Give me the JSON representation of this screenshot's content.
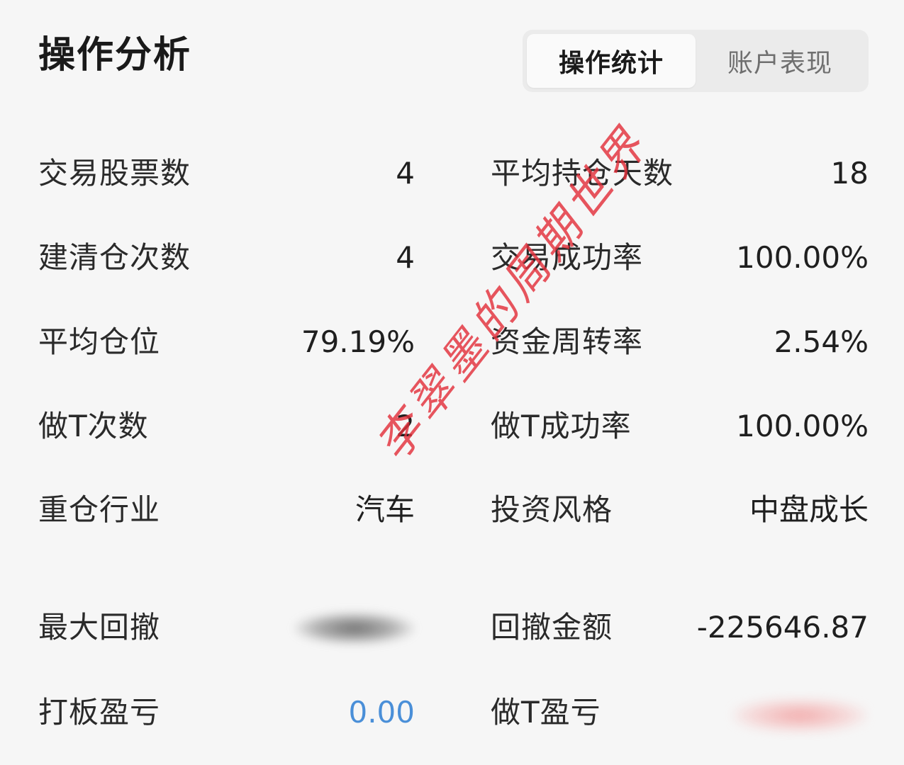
{
  "header": {
    "title": "操作分析",
    "tabs": [
      {
        "label": "操作统计",
        "active": true
      },
      {
        "label": "账户表现",
        "active": false
      }
    ]
  },
  "stats": {
    "rows": [
      {
        "left_label": "交易股票数",
        "left_value": "4",
        "right_label": "平均持仓天数",
        "right_value": "18"
      },
      {
        "left_label": "建清仓次数",
        "left_value": "4",
        "right_label": "交易成功率",
        "right_value": "100.00%"
      },
      {
        "left_label": "平均仓位",
        "left_value": "79.19%",
        "right_label": "资金周转率",
        "right_value": "2.54%"
      },
      {
        "left_label": "做T次数",
        "left_value": "2",
        "right_label": "做T成功率",
        "right_value": "100.00%"
      },
      {
        "left_label": "重仓行业",
        "left_value": "汽车",
        "right_label": "投资风格",
        "right_value": "中盘成长"
      },
      {
        "left_label": "最大回撤",
        "left_value": "",
        "right_label": "回撤金额",
        "right_value": "-225646.87"
      },
      {
        "left_label": "打板盈亏",
        "left_value": "0.00",
        "right_label": "做T盈亏",
        "right_value": ""
      }
    ]
  },
  "watermark": {
    "text": "李翠墨的周期世界"
  },
  "colors": {
    "accent_blue": "#4a8fd8",
    "watermark_red": "#e2303a",
    "background": "#f6f6f6"
  }
}
